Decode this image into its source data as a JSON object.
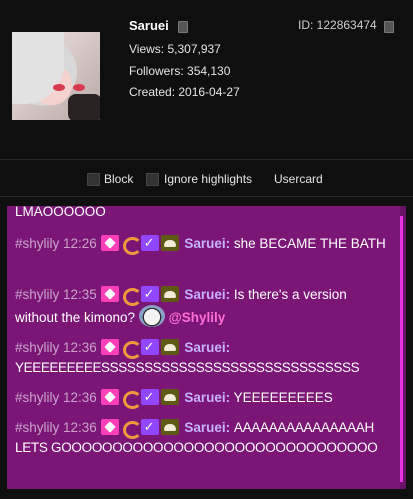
{
  "profile": {
    "username": "Saruei",
    "id_label": "ID: 122863474",
    "views": "Views: 5,307,937",
    "followers": "Followers: 354,130",
    "created": "Created: 2016-04-27"
  },
  "options": {
    "block_label": "Block",
    "ignore_label": "Ignore highlights",
    "usercard_label": "Usercard"
  },
  "chat": {
    "partial_top": "LMAOOOOOO",
    "messages": [
      {
        "channel": "#shylily",
        "time": "12:26",
        "user": "Saruei:",
        "text": "she BECAME THE BATH"
      },
      {
        "channel": "#shylily",
        "time": "12:35",
        "user": "Saruei:",
        "text": "Is there's a version without the kimono?",
        "mention": "@Shylily"
      },
      {
        "channel": "#shylily",
        "time": "12:36",
        "user": "Saruei:",
        "text": "YEEEEEEEEESSSSSSSSSSSSSSSSSSSSSSSSSSSSSS"
      },
      {
        "channel": "#shylily",
        "time": "12:36",
        "user": "Saruei:",
        "text": "YEEEEEEEEES"
      },
      {
        "channel": "#shylily",
        "time": "12:36",
        "user": "Saruei:",
        "text": "AAAAAAAAAAAAAAAH LETS GOOOOOOOOOOOOOOOOOOOOOOOOOOOOOOO"
      }
    ]
  },
  "colors": {
    "chat_bg": "#7b1677",
    "username": "#c7b2ff",
    "mention": "#ff6fd4",
    "scroll_thumb": "#e535e3"
  },
  "icons": [
    "copy-icon",
    "sub-badge-icon",
    "shrimp-badge-icon",
    "verified-badge-icon",
    "turbo-badge-icon",
    "avatar-emote"
  ]
}
